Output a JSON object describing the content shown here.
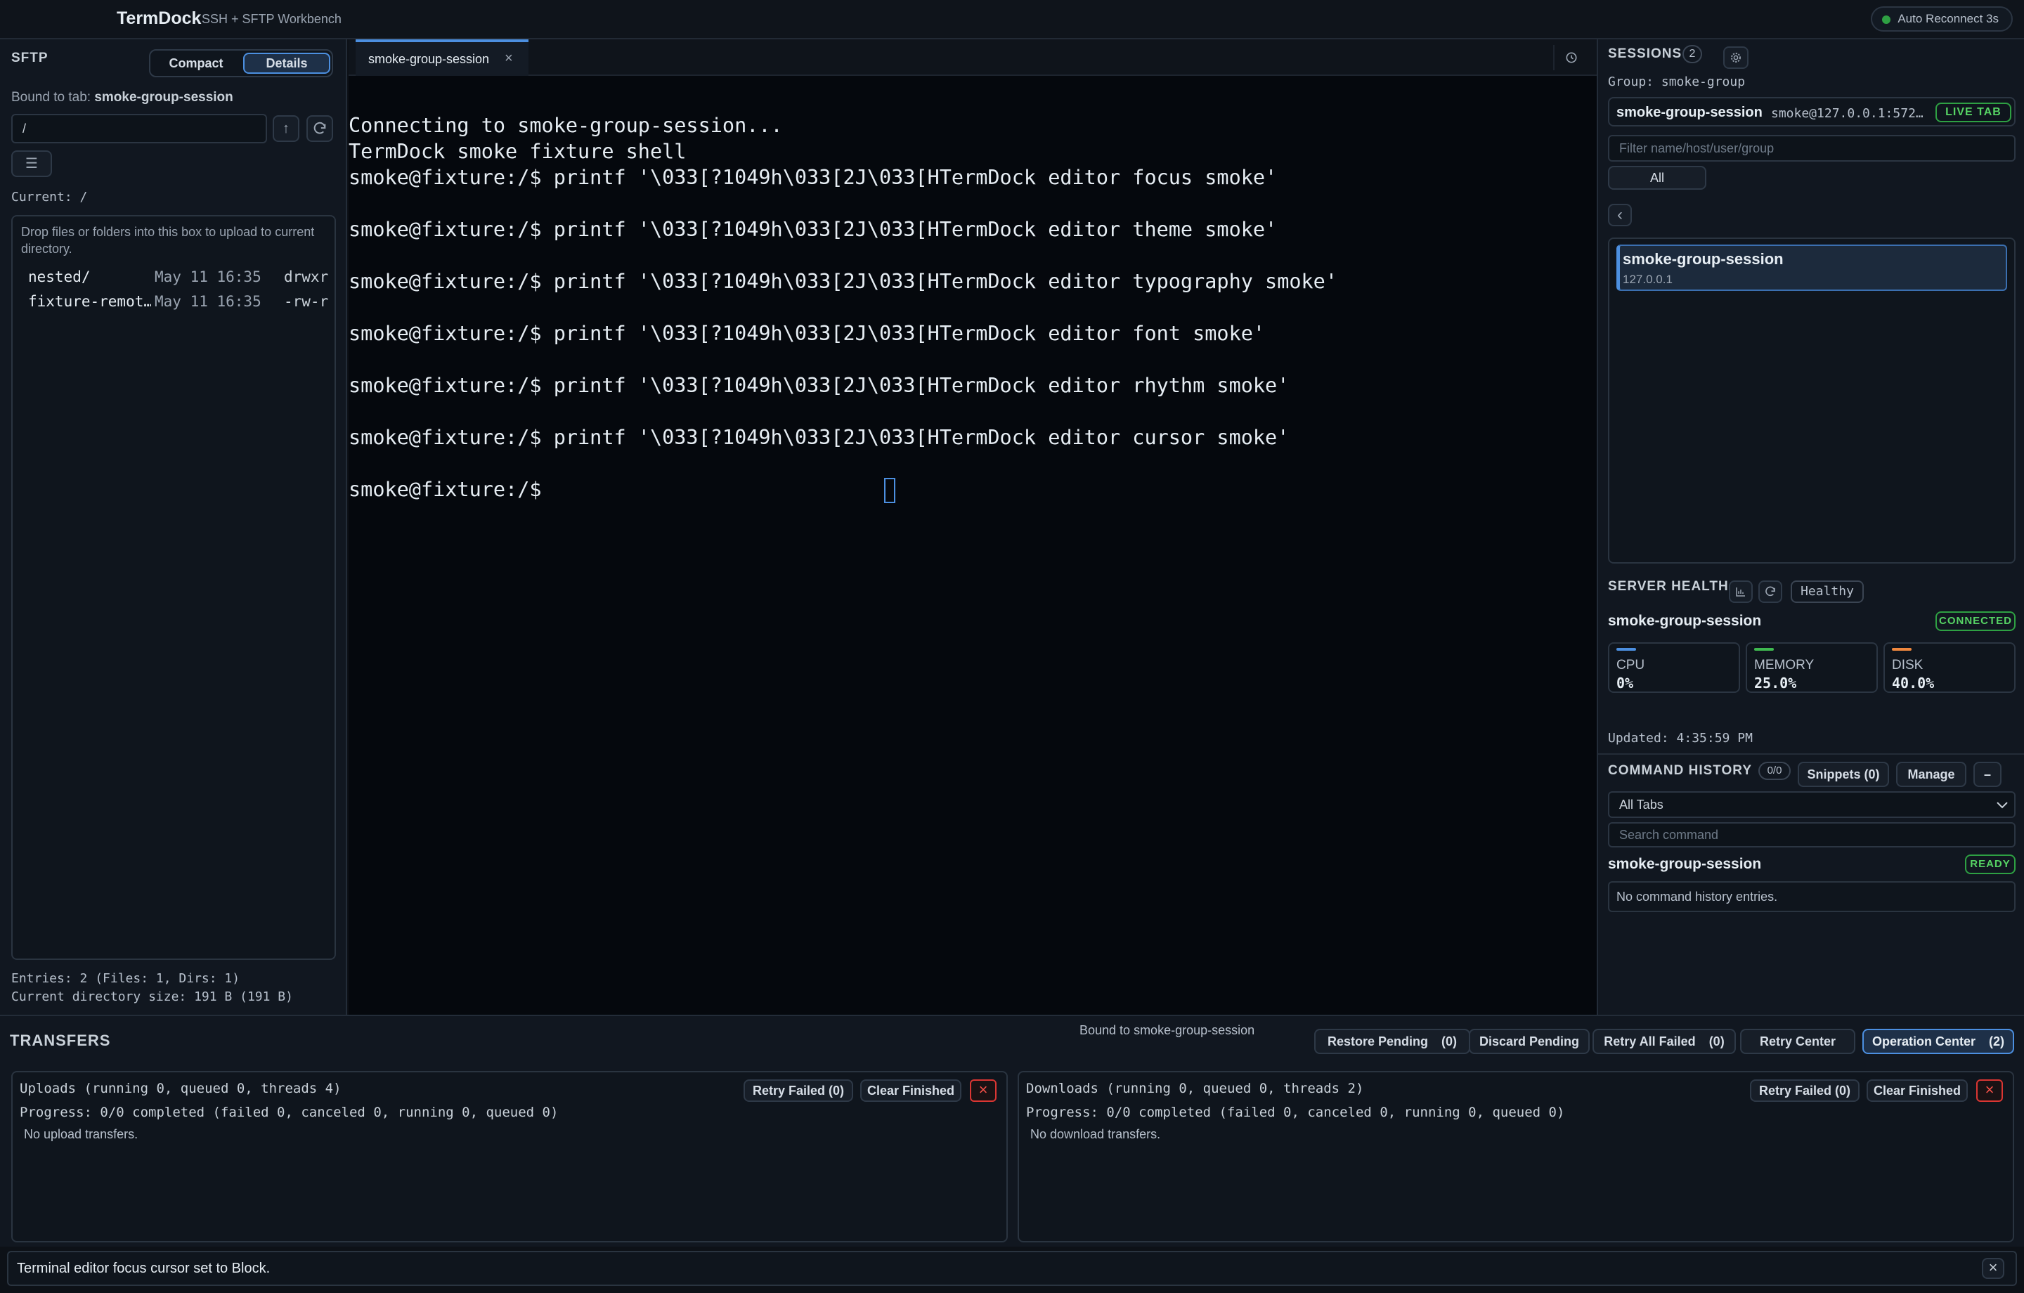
{
  "app": {
    "name": "TermDock",
    "subtitle": "SSH + SFTP Workbench",
    "auto_reconnect": "Auto Reconnect 3s"
  },
  "sftp": {
    "title": "SFTP",
    "view_compact": "Compact",
    "view_details": "Details",
    "bound_prefix": "Bound to tab: ",
    "bound_tab": "smoke-group-session",
    "path_value": "/",
    "current_label": "Current: /",
    "drop_hint": "Drop files or folders into this box to upload to current directory.",
    "files": [
      {
        "name": "nested/",
        "date": "May 11 16:35",
        "perm": "drwxr"
      },
      {
        "name": "fixture-remot…",
        "date": "May 11 16:35",
        "perm": "-rw-r"
      }
    ],
    "entries_summary": "Entries: 2 (Files: 1, Dirs: 1)",
    "dir_size": "Current directory size: 191 B (191 B)"
  },
  "terminal": {
    "tab_label": "smoke-group-session",
    "lines": [
      "Connecting to smoke-group-session...",
      "TermDock smoke fixture shell",
      "smoke@fixture:/$ printf '\\033[?1049h\\033[2J\\033[HTermDock editor focus smoke'",
      "smoke@fixture:/$ printf '\\033[?1049h\\033[2J\\033[HTermDock editor theme smoke'",
      "smoke@fixture:/$ printf '\\033[?1049h\\033[2J\\033[HTermDock editor typography smoke'",
      "smoke@fixture:/$ printf '\\033[?1049h\\033[2J\\033[HTermDock editor font smoke'",
      "smoke@fixture:/$ printf '\\033[?1049h\\033[2J\\033[HTermDock editor rhythm smoke'",
      "smoke@fixture:/$ printf '\\033[?1049h\\033[2J\\033[HTermDock editor cursor smoke'",
      "smoke@fixture:/$ "
    ]
  },
  "sessions": {
    "title": "SESSIONS",
    "count": "2",
    "group_label": "Group: smoke-group",
    "live_name": "smoke-group-session",
    "live_host": "smoke@127.0.0.1:572…",
    "live_badge": "LIVE TAB",
    "filter_placeholder": "Filter name/host/user/group",
    "filter_all": "All",
    "list": [
      {
        "name": "smoke-group-session",
        "host": "127.0.0.1"
      }
    ]
  },
  "health": {
    "title": "SERVER HEALTH",
    "status": "Healthy",
    "session": "smoke-group-session",
    "connected": "CONNECTED",
    "cpu_label": "CPU",
    "cpu_value": "0%",
    "mem_label": "MEMORY",
    "mem_value": "25.0%",
    "disk_label": "DISK",
    "disk_value": "40.0%",
    "updated": "Updated: 4:35:59 PM",
    "colors": {
      "cpu": "#4c8fe0",
      "memory": "#3fb950",
      "disk": "#f0883e"
    }
  },
  "history": {
    "title": "COMMAND HISTORY",
    "count": "0/0",
    "snippets": "Snippets (0)",
    "manage": "Manage",
    "collapse": "–",
    "scope": "All Tabs",
    "search_placeholder": "Search command",
    "session": "smoke-group-session",
    "ready": "READY",
    "empty": "No command history entries."
  },
  "transfers": {
    "title": "TRANSFERS",
    "bound": "Bound to smoke-group-session",
    "restore_pending": "Restore Pending",
    "restore_count": "(0)",
    "discard_pending": "Discard Pending",
    "retry_all_failed": "Retry All Failed",
    "retry_all_count": "(0)",
    "retry_center": "Retry Center",
    "operation_center": "Operation Center",
    "operation_count": "(2)",
    "uploads": {
      "title": "Uploads (running 0, queued 0, threads 4)",
      "progress": "Progress: 0/0 completed (failed 0, canceled 0, running 0, queued 0)",
      "empty": "No upload transfers.",
      "retry": "Retry Failed (0)",
      "clear": "Clear Finished"
    },
    "downloads": {
      "title": "Downloads (running 0, queued 0, threads 2)",
      "progress": "Progress: 0/0 completed (failed 0, canceled 0, running 0, queued 0)",
      "empty": "No download transfers.",
      "retry": "Retry Failed (0)",
      "clear": "Clear Finished"
    }
  },
  "status": {
    "message": "Terminal editor focus cursor set to Block."
  },
  "icons": {
    "close": "×",
    "up": "↑",
    "menu": "☰",
    "back": "‹",
    "chevron": "⌄"
  }
}
